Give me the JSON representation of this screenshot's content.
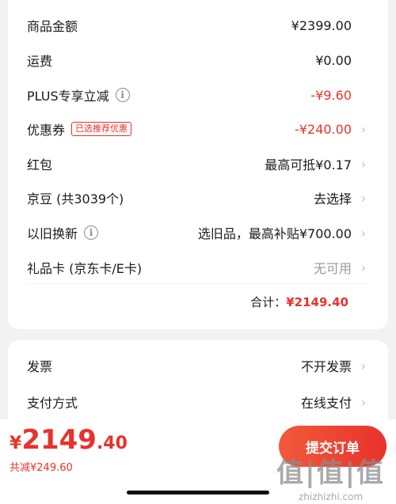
{
  "order_summary": {
    "rows": [
      {
        "label": "商品金额",
        "value": "¥2399.00"
      },
      {
        "label": "运费",
        "value": "¥0.00"
      },
      {
        "label": "PLUS专享立减",
        "value": "-¥9.60"
      },
      {
        "label": "优惠券",
        "tag": "已选推荐优惠",
        "value": "-¥240.00"
      },
      {
        "label": "红包",
        "value": "最高可抵¥0.17"
      },
      {
        "label": "京豆 (共3039个)",
        "value": "去选择"
      },
      {
        "label": "以旧换新",
        "value": "选旧品，最高补贴¥700.00"
      },
      {
        "label": "礼品卡 (京东卡/E卡)",
        "value": "无可用"
      }
    ],
    "total_label": "合计：",
    "total_value": "¥2149.40"
  },
  "invoice_payment": {
    "rows": [
      {
        "label": "发票",
        "value": "不开发票"
      },
      {
        "label": "支付方式",
        "value": "在线支付"
      }
    ]
  },
  "bottom_bar": {
    "currency": "¥",
    "price_int": "2149",
    "price_dec": ".40",
    "saved": "共减¥249.60",
    "submit_label": "提交订单"
  },
  "watermark": {
    "mark": "值|值|值",
    "text": "zhizhizhi.com"
  },
  "icons": {
    "info": "info-circle-icon",
    "chevron": "chevron-right-icon"
  },
  "colors": {
    "accent": "#e8322c",
    "background": "#f2f2f2",
    "muted": "#9b9b9b"
  }
}
